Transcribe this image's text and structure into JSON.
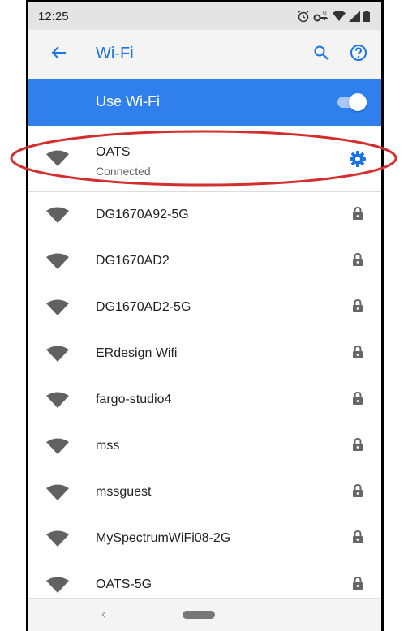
{
  "status_bar": {
    "time": "12:25",
    "icons": [
      "alarm-icon",
      "vpn-key-icon",
      "wifi-signal-icon",
      "cell-signal-icon",
      "battery-icon"
    ]
  },
  "app_bar": {
    "back_icon": "arrow-left-icon",
    "title": "Wi-Fi",
    "search_icon": "search-icon",
    "help_icon": "help-circle-icon"
  },
  "use_wifi": {
    "label": "Use Wi-Fi",
    "enabled": true
  },
  "connected_network": {
    "name": "OATS",
    "status": "Connected",
    "settings_icon": "gear-icon"
  },
  "networks": [
    {
      "name": "DG1670A92-5G",
      "secured": true
    },
    {
      "name": "DG1670AD2",
      "secured": true
    },
    {
      "name": "DG1670AD2-5G",
      "secured": true
    },
    {
      "name": "ERdesign Wifi",
      "secured": true
    },
    {
      "name": "fargo-studio4",
      "secured": true
    },
    {
      "name": "mss",
      "secured": true
    },
    {
      "name": "mssguest",
      "secured": true
    },
    {
      "name": "MySpectrumWiFi08-2G",
      "secured": true
    },
    {
      "name": "OATS-5G",
      "secured": true
    }
  ],
  "nav_bar": {
    "back": "‹",
    "home_icon": "home-pill-icon"
  },
  "colors": {
    "accent": "#1a73e8",
    "toggle_bar": "#2f80ed",
    "annotation": "#d32f2f"
  }
}
